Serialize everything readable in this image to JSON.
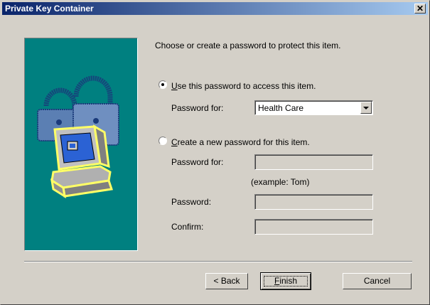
{
  "window": {
    "title": "Private Key Container"
  },
  "intro": "Choose or create a password to protect this item.",
  "option_use": {
    "label_ul": "U",
    "label_rest": "se this password to access this item.",
    "selected": true,
    "password_for_label": "Password for:",
    "password_for_value": "Health Care"
  },
  "option_create": {
    "label_ul": "C",
    "label_rest": "reate a new password for this item.",
    "selected": false,
    "password_for_label": "Password for:",
    "example": "(example: Tom)",
    "password_label": "Password:",
    "confirm_label": "Confirm:"
  },
  "buttons": {
    "back": "< Back",
    "finish_ul": "F",
    "finish_rest": "inish",
    "cancel": "Cancel"
  },
  "colors": {
    "art_bg": "#008080",
    "title_gradient_start": "#0a246a",
    "title_gradient_end": "#a6caf0"
  },
  "icons": [
    "close-icon",
    "padlock-illustration",
    "computer-illustration",
    "dropdown-arrow-icon"
  ]
}
